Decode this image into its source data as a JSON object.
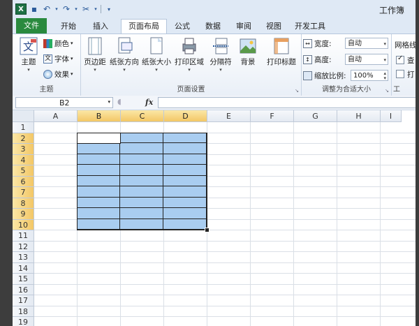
{
  "window": {
    "title": "工作簿"
  },
  "qat": {
    "app_icon": "X"
  },
  "tabs": [
    {
      "label": "文件"
    },
    {
      "label": "开始"
    },
    {
      "label": "插入"
    },
    {
      "label": "页面布局"
    },
    {
      "label": "公式"
    },
    {
      "label": "数据"
    },
    {
      "label": "审阅"
    },
    {
      "label": "视图"
    },
    {
      "label": "开发工具"
    }
  ],
  "ribbon": {
    "theme_group": {
      "label": "主题",
      "theme_button": "主题",
      "colors": "颜色",
      "fonts": "字体",
      "effects": "效果"
    },
    "page_setup_group": {
      "label": "页面设置",
      "margins": "页边距",
      "orientation": "纸张方向",
      "size": "纸张大小",
      "print_area": "打印区域",
      "breaks": "分隔符",
      "background": "背景",
      "print_titles": "打印标题"
    },
    "scale_group": {
      "label": "调整为合适大小",
      "width_label": "宽度:",
      "width_value": "自动",
      "height_label": "高度:",
      "height_value": "自动",
      "scale_label": "缩放比例:",
      "scale_value": "100%"
    },
    "sheet_options_group": {
      "label": "工",
      "gridlines": "网格线",
      "view": "查",
      "print": "打"
    }
  },
  "formula_bar": {
    "name_box": "B2",
    "fx": "fx",
    "content": ""
  },
  "grid": {
    "columns": [
      "A",
      "B",
      "C",
      "D",
      "E",
      "F",
      "G",
      "H",
      "I"
    ],
    "rows": [
      "1",
      "2",
      "3",
      "4",
      "5",
      "6",
      "7",
      "8",
      "9",
      "10",
      "11",
      "12",
      "13",
      "14",
      "15",
      "16",
      "17",
      "18",
      "19"
    ],
    "selected_columns": [
      "B",
      "C",
      "D"
    ],
    "selected_rows": [
      "2",
      "3",
      "4",
      "5",
      "6",
      "7",
      "8",
      "9",
      "10"
    ],
    "selection_fill": "#a9cdf0",
    "header_highlight": "#f3c766"
  }
}
